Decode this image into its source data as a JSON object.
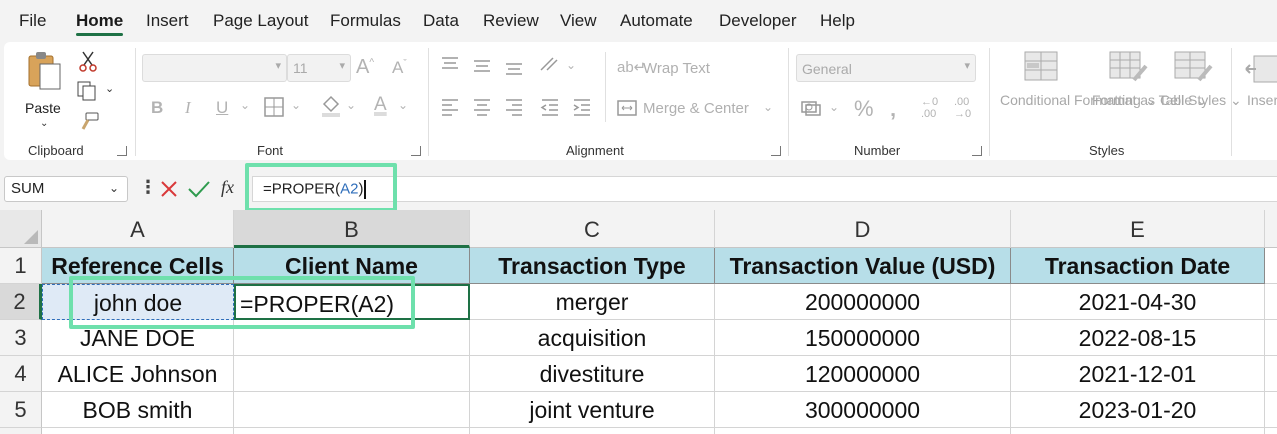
{
  "menu": {
    "file": "File",
    "home": "Home",
    "insert": "Insert",
    "page_layout": "Page Layout",
    "formulas": "Formulas",
    "data": "Data",
    "review": "Review",
    "view": "View",
    "automate": "Automate",
    "developer": "Developer",
    "help": "Help"
  },
  "ribbon": {
    "paste_label": "Paste",
    "font_size": "11",
    "wrap_text": "Wrap Text",
    "merge_center": "Merge & Center",
    "number_format": "General",
    "conditional_formatting": "Conditional Formatting",
    "format_as_table": "Format as Table",
    "cell_styles": "Cell Styles",
    "insert_cut": "Inser",
    "groups": {
      "clipboard": "Clipboard",
      "font": "Font",
      "alignment": "Alignment",
      "number": "Number",
      "styles": "Styles"
    }
  },
  "formula_bar": {
    "name_box": "SUM",
    "formula_prefix": "=PROPER(",
    "formula_ref": "A2",
    "formula_suffix": ")",
    "fx": "fx"
  },
  "grid": {
    "columns": [
      "A",
      "B",
      "C",
      "D",
      "E"
    ],
    "rows": [
      "1",
      "2",
      "3",
      "4",
      "5"
    ],
    "headers": [
      "Reference Cells",
      "Client Name",
      "Transaction Type",
      "Transaction Value (USD)",
      "Transaction Date"
    ],
    "data": [
      [
        "john doe",
        "=PROPER(A2)",
        "merger",
        "200000000",
        "2021-04-30"
      ],
      [
        "JANE DOE",
        "",
        "acquisition",
        "150000000",
        "2022-08-15"
      ],
      [
        "ALICE Johnson",
        "",
        "divestiture",
        "120000000",
        "2021-12-01"
      ],
      [
        "BOB smith",
        "",
        "joint venture",
        "300000000",
        "2023-01-20"
      ]
    ]
  },
  "colors": {
    "accent": "#1e7145",
    "header_fill": "#b7dee8",
    "highlight_box": "#6ee0ac",
    "reference_blue": "#2f6eba"
  }
}
